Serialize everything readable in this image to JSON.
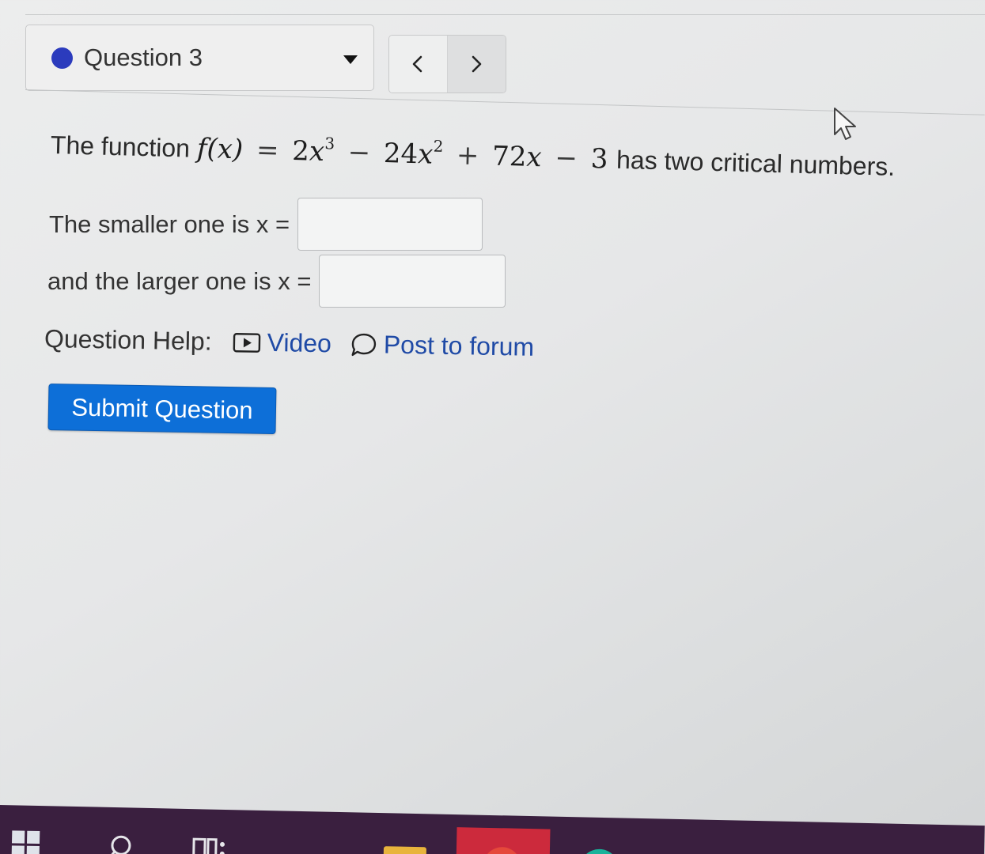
{
  "question_nav": {
    "label": "Question 3",
    "status_color": "#2b3bbd",
    "prev_icon": "chevron-left-icon",
    "next_icon": "chevron-right-icon"
  },
  "prompt": {
    "lead": "The function",
    "math": {
      "fn": "f(x)",
      "eq": "=",
      "t1_coef": "2",
      "t1_var": "x",
      "t1_exp": "3",
      "op1": "−",
      "t2_coef": "24",
      "t2_var": "x",
      "t2_exp": "2",
      "op2": "+",
      "t3_coef": "72",
      "t3_var": "x",
      "op3": "−",
      "t4": "3"
    },
    "tail": "has two critical numbers."
  },
  "answers": {
    "smaller_label": "The smaller one is x =",
    "smaller_value": "",
    "larger_label": "and the larger one is x =",
    "larger_value": ""
  },
  "help": {
    "label": "Question Help:",
    "video_label": "Video",
    "forum_label": "Post to forum",
    "link_color": "#1f4aa6"
  },
  "submit": {
    "label": "Submit Question",
    "color": "#0d6fd8"
  },
  "taskbar": {
    "icons": [
      "windows-icon",
      "search-icon",
      "task-view-icon",
      "file-explorer-icon",
      "browser-icon",
      "app-icon",
      "app-icon",
      "app-icon"
    ]
  }
}
